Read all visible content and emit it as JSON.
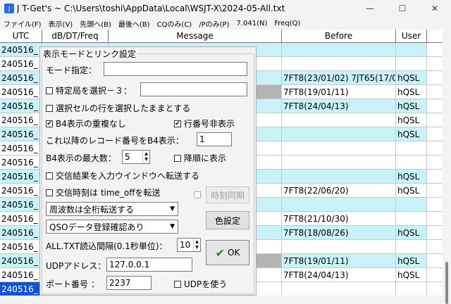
{
  "window": {
    "app_icon": "J",
    "title": "J T-Get's ~ C:\\Users\\toshi\\AppData\\Local\\WSJT-X\\2024-05-All.txt",
    "minimize": "—",
    "maximize": "☐",
    "close": "✕"
  },
  "menu": [
    "ファイル(F)",
    "表示(V)",
    "先頭へ(B)",
    "最後へ(B)",
    "CQのみ(C)",
    "/Pのみ(P)",
    "7.041(N)",
    "Freq(Q)"
  ],
  "grid": {
    "headers": {
      "utc": "UTC",
      "db": "dB/DT/Freq",
      "message": "Message",
      "before": "Before",
      "user": "User"
    },
    "rows": [
      {
        "utc": "240516_",
        "before": "",
        "user": "",
        "style": "cyan"
      },
      {
        "utc": "240516_",
        "before": "",
        "user": "",
        "style": "white"
      },
      {
        "utc": "240516_",
        "before": "7FT8(23/01/02) 7JT65(17/0",
        "user": "hQSL",
        "style": "cyan"
      },
      {
        "utc": "240516_",
        "before": "7FT8(19/01/11)",
        "user": "hQSL",
        "style": "white"
      },
      {
        "utc": "240516_",
        "before": "7FT8(24/04/13)",
        "user": "hQSL",
        "style": "cyan"
      },
      {
        "utc": "240516_",
        "before": "",
        "user": "hQSL",
        "style": "white"
      },
      {
        "utc": "240516_",
        "before": "",
        "user": "hQSL",
        "style": "cyan"
      },
      {
        "utc": "240516_",
        "before": "",
        "user": "",
        "style": "white"
      },
      {
        "utc": "240516_",
        "before": "",
        "user": "",
        "style": "white"
      },
      {
        "utc": "240516_",
        "before": "",
        "user": "hQSL",
        "style": "cyan"
      },
      {
        "utc": "240516_",
        "before": "7FT8(22/06/20)",
        "user": "hQSL",
        "style": "white"
      },
      {
        "utc": "240516_",
        "before": "",
        "user": "",
        "style": "cyan"
      },
      {
        "utc": "240516_",
        "before": "7FT8(21/10/30)",
        "user": "",
        "style": "white"
      },
      {
        "utc": "240516_",
        "before": "7FT8(18/08/26)",
        "user": "hQSL",
        "style": "cyan"
      },
      {
        "utc": "240516_",
        "before": "",
        "user": "",
        "style": "white"
      },
      {
        "utc": "240516_",
        "before": "7FT8(19/01/11)",
        "user": "hQSL",
        "style": "cyan"
      },
      {
        "utc": "240516_",
        "before": "7FT8(24/04/13)",
        "user": "hQSL",
        "style": "white"
      },
      {
        "utc": "240516_",
        "before": "",
        "user": "",
        "style": "sel"
      }
    ]
  },
  "dialog": {
    "title": "表示モードとリンク設定",
    "mode_label": "モード指定：",
    "mode_value": "",
    "specific_station_label": "特定局を選択－３：",
    "specific_station_value": "",
    "keep_selection_label": "選択セルの行を選択したままとする",
    "no_b4_duplicate_label": "B4表示の重複なし",
    "no_b4_duplicate_checked": "✔",
    "hide_row_number_label": "行番号非表示",
    "hide_row_number_checked": "✔",
    "b4_record_label": "これ以降のレコード番号をB4表示：",
    "b4_record_value": "1",
    "b4_max_label": "B4表示の最大数：",
    "b4_max_value": "5",
    "descending_label": "降順に表示",
    "transfer_result_label": "交信結果を入力ウインドウへ転送する",
    "transfer_time_label": "交信時刻は time_offを転送",
    "time_sync_label": "時刻同期",
    "freq_combo_value": "周波数は全桁転送する",
    "qso_combo_value": "QSOデータ登録確認あり",
    "color_button_label": "色設定",
    "interval_label": "ALL.TXT読込間隔(0.1秒単位)：",
    "interval_value": "10",
    "udp_address_label": "UDPアドレス：",
    "udp_address_value": "127.0.0.1",
    "port_label": "ポート番号 ：",
    "port_value": "2237",
    "use_udp_label": "UDPを使う",
    "ok_label": "OK",
    "ok_icon": "✔"
  }
}
